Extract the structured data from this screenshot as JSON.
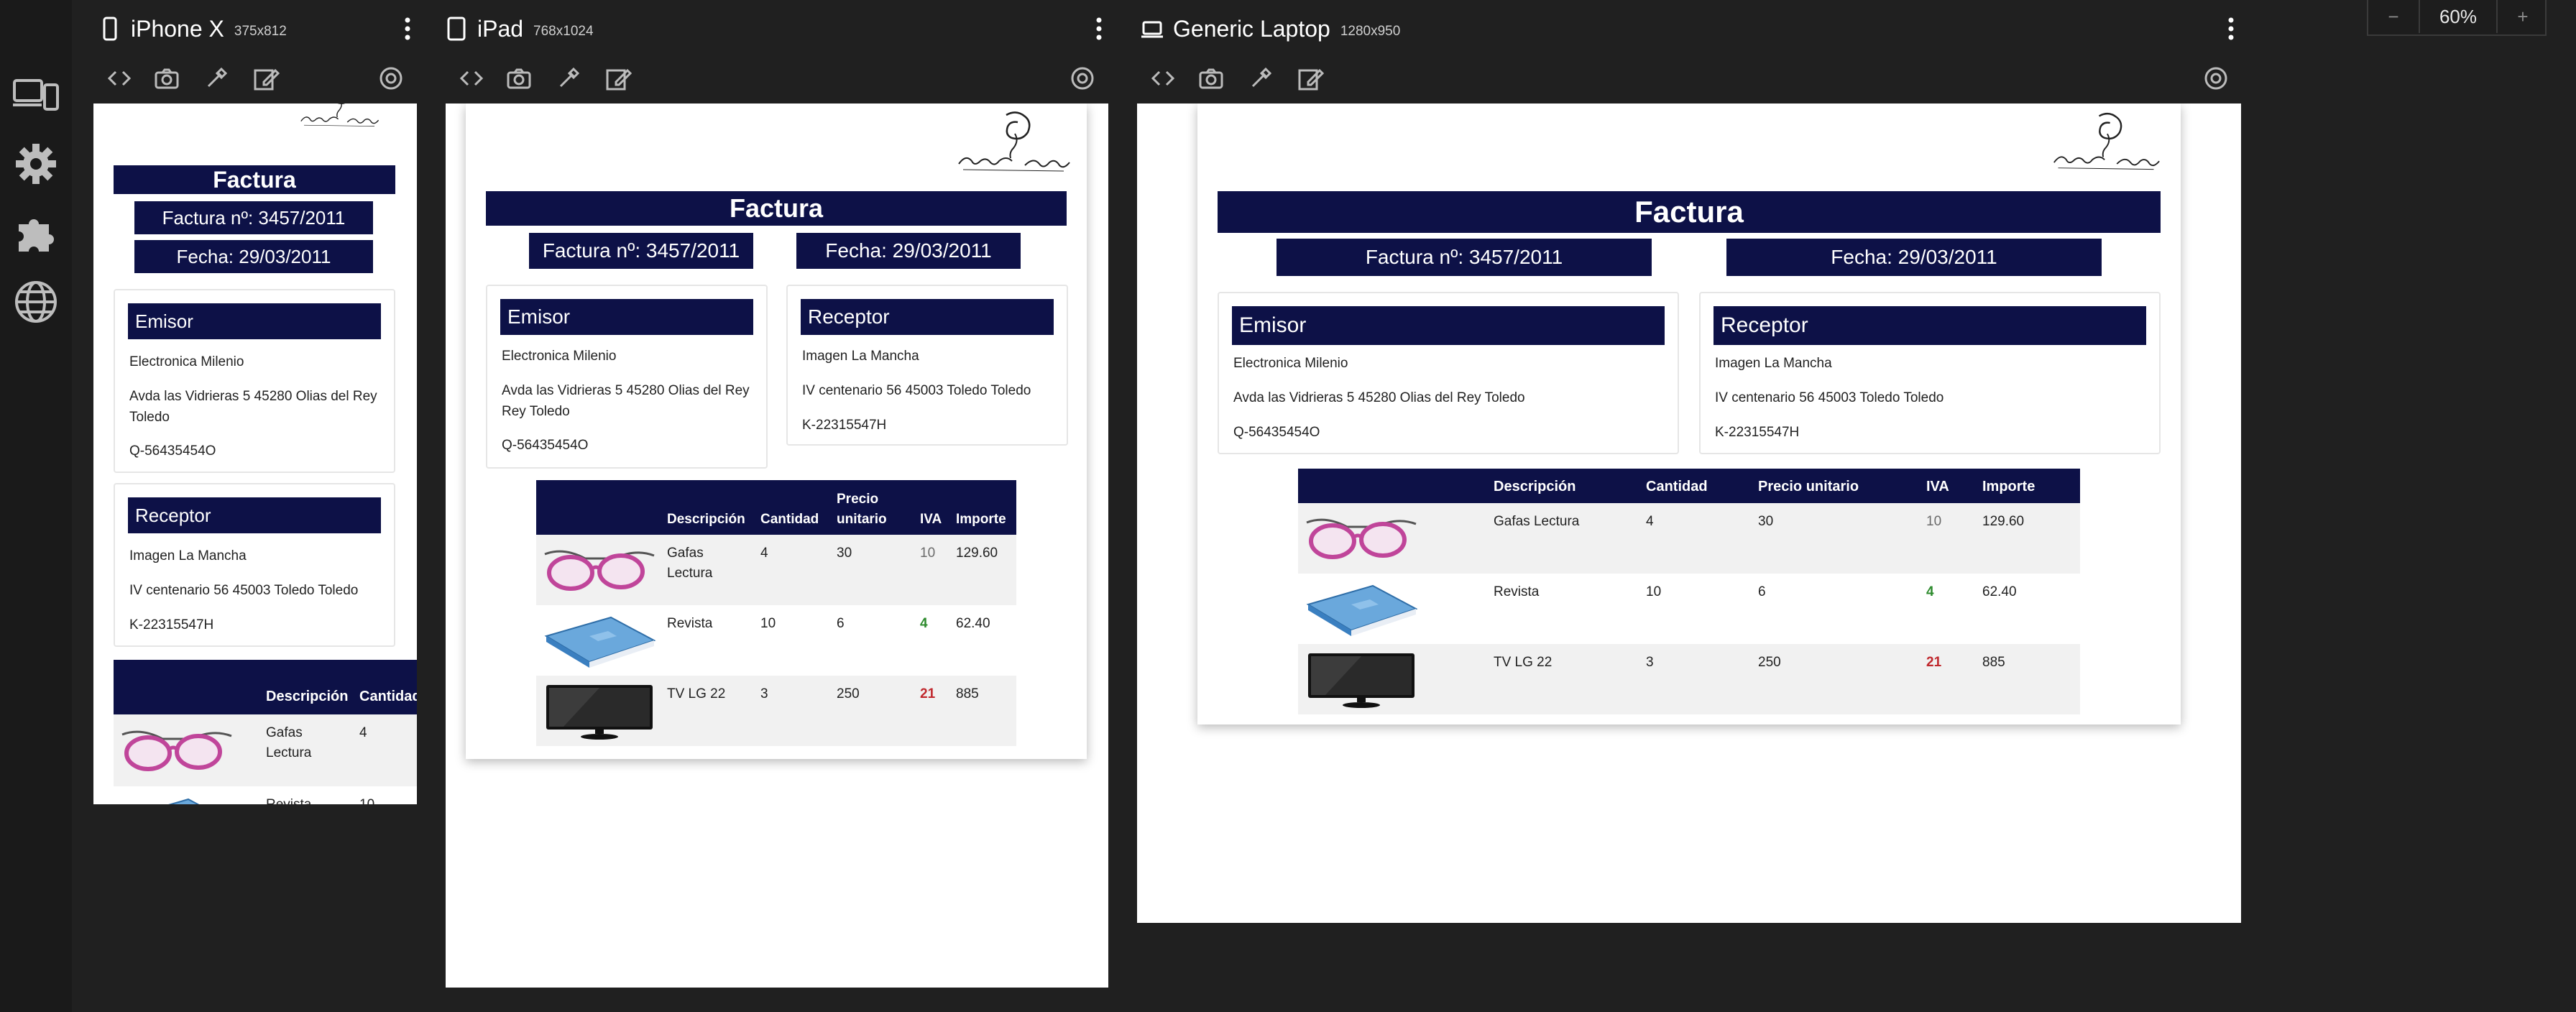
{
  "sidebar": {
    "items": [
      {
        "icon": "devices-icon"
      },
      {
        "icon": "gear-icon"
      },
      {
        "icon": "puzzle-icon"
      },
      {
        "icon": "globe-icon"
      }
    ]
  },
  "devices": [
    {
      "name": "iPhone X",
      "size": "375x812",
      "icon": "phone-icon"
    },
    {
      "name": "iPad",
      "size": "768x1024",
      "icon": "tablet-icon"
    },
    {
      "name": "Generic Laptop",
      "size": "1280x950",
      "icon": "laptop-icon"
    }
  ],
  "toolbar": {
    "icons": [
      "code-icon",
      "camera-icon",
      "eyedropper-icon",
      "edit-icon",
      "rotate-icon"
    ]
  },
  "zoom": {
    "minus": "−",
    "value": "60%",
    "plus": "+"
  },
  "invoice": {
    "title": "Factura",
    "number": "Factura nº: 3457/2011",
    "date": "Fecha: 29/03/2011",
    "emisor": {
      "heading": "Emisor",
      "name": "Electronica Milenio",
      "address": "Avda las Vidrieras 5 45280 Olias del Rey Toledo",
      "address_wrap_a": "Avda las Vidrieras 5 45280 Olias del Rey",
      "address_wrap_b": "Toledo",
      "address_wrap_c": "Rey Toledo",
      "tax_id": "Q-56435454O"
    },
    "receptor": {
      "heading": "Receptor",
      "name": "Imagen La Mancha",
      "address": "IV centenario 56 45003 Toledo Toledo",
      "tax_id": "K-22315547H"
    },
    "table": {
      "headers": {
        "descripcion": "Descripción",
        "cantidad": "Cantidad",
        "precio": "Precio unitario",
        "precio_a": "Precio",
        "precio_b": "unitario",
        "iva": "IVA",
        "importe": "Importe"
      },
      "rows": [
        {
          "image": "glasses-image",
          "descripcion": "Gafas Lectura",
          "descripcion_a": "Gafas",
          "descripcion_b": "Lectura",
          "cantidad": "4",
          "precio": "30",
          "iva": "10",
          "importe": "129.60",
          "iva_color": "#6b6b6b"
        },
        {
          "image": "book-image",
          "descripcion": "Revista",
          "cantidad": "10",
          "precio": "6",
          "iva": "4",
          "importe": "62.40",
          "iva_color": "#2e8b2e"
        },
        {
          "image": "tv-image",
          "descripcion": "TV LG 22",
          "cantidad": "3",
          "precio": "250",
          "iva": "21",
          "importe": "885",
          "iva_color": "#c0282d"
        }
      ]
    }
  },
  "colors": {
    "navy": "#0d1147",
    "background": "#202020",
    "sidebar": "#1a1a1a",
    "row_alt": "#f1f1f1"
  }
}
